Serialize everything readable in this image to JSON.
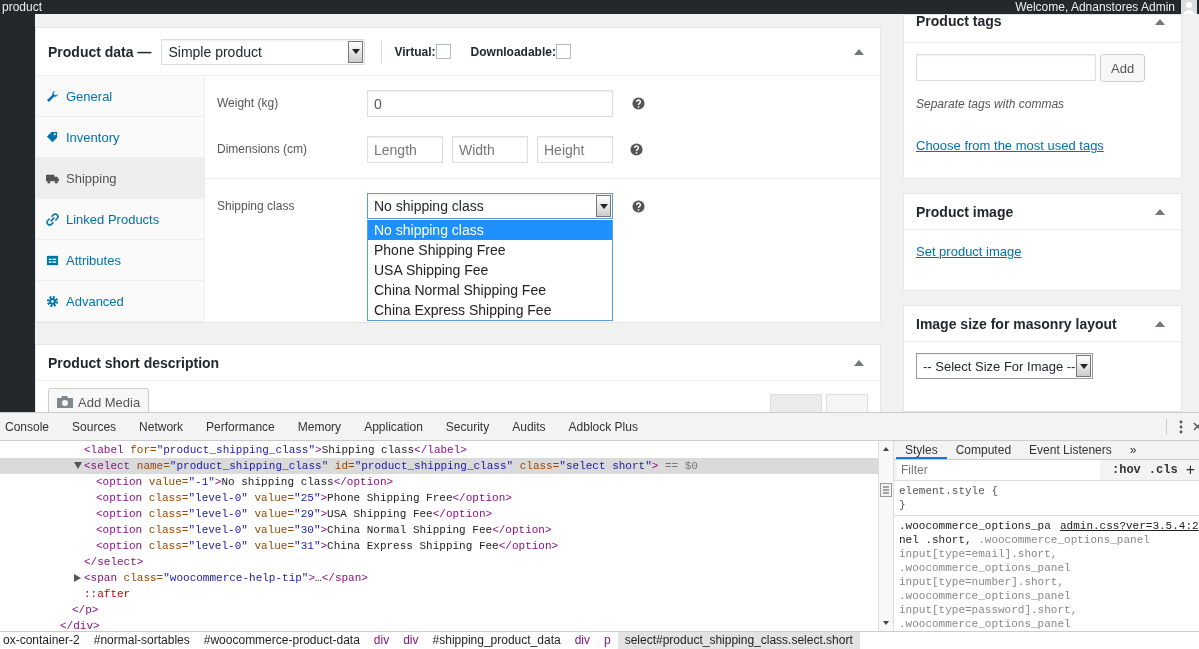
{
  "admin_bar": {
    "title": "product",
    "welcome": "Welcome, Adnanstores Admin"
  },
  "product_data": {
    "title": "Product data —",
    "type_select": "Simple product",
    "virtual": {
      "label": "Virtual:",
      "checked": false
    },
    "downloadable": {
      "label": "Downloadable:",
      "checked": false
    },
    "tabs": [
      {
        "label": "General",
        "selected": false
      },
      {
        "label": "Inventory",
        "selected": false
      },
      {
        "label": "Shipping",
        "selected": true
      },
      {
        "label": "Linked Products",
        "selected": false
      },
      {
        "label": "Attributes",
        "selected": false
      },
      {
        "label": "Advanced",
        "selected": false
      }
    ],
    "weight": {
      "label": "Weight (kg)",
      "value": "0"
    },
    "dimensions": {
      "label": "Dimensions (cm)",
      "placeholders": [
        "Length",
        "Width",
        "Height"
      ]
    },
    "shipping_class": {
      "label": "Shipping class",
      "value": "No shipping class",
      "expanded": true,
      "options": [
        {
          "label": "No shipping class",
          "selected": true
        },
        {
          "label": "Phone Shipping Free",
          "selected": false
        },
        {
          "label": "USA Shipping Fee",
          "selected": false
        },
        {
          "label": "China Normal Shipping Fee",
          "selected": false
        },
        {
          "label": "China Express Shipping Fee",
          "selected": false
        }
      ]
    }
  },
  "short_description": {
    "title": "Product short description",
    "add_media": "Add Media"
  },
  "product_tags": {
    "title": "Product tags",
    "button": "Add",
    "hint": "Separate tags with commas",
    "link": "Choose from the most used tags"
  },
  "product_image": {
    "title": "Product image",
    "link": "Set product image"
  },
  "image_size": {
    "title": "Image size for masonry layout",
    "select": "-- Select Size For Image --"
  },
  "devtools": {
    "tabs": [
      "Console",
      "Sources",
      "Network",
      "Performance",
      "Memory",
      "Application",
      "Security",
      "Audits",
      "Adblock Plus"
    ],
    "elements": {
      "nodes": [
        {
          "children": [
            {
              "children": [
                {
                  "selected": false,
                  "line": [
                    {
                      "kind": "tag",
                      "text": "<label"
                    },
                    {
                      "kind": "attr",
                      "text": " for="
                    },
                    {
                      "kind": "value",
                      "text": "\"product_shipping_class\""
                    },
                    {
                      "kind": "tag",
                      "text": ">"
                    },
                    {
                      "kind": "text",
                      "text": "Shipping class"
                    },
                    {
                      "kind": "tag",
                      "text": "</label>"
                    }
                  ]
                },
                {
                  "selected": true,
                  "expanded": true,
                  "line": [
                    {
                      "kind": "tag",
                      "text": "<select"
                    },
                    {
                      "kind": "attr",
                      "text": " name="
                    },
                    {
                      "kind": "value",
                      "text": "\"product_shipping_class\""
                    },
                    {
                      "kind": "attr",
                      "text": " id="
                    },
                    {
                      "kind": "value",
                      "text": "\"product_shipping_class\""
                    },
                    {
                      "kind": "attr",
                      "text": " class="
                    },
                    {
                      "kind": "value",
                      "text": "\"select short\""
                    },
                    {
                      "kind": "tag",
                      "text": ">"
                    },
                    {
                      "kind": "marker",
                      "text": " == $0"
                    }
                  ],
                  "children": [
                    {
                      "selected": false,
                      "line": [
                        {
                          "kind": "tag",
                          "text": "<option"
                        },
                        {
                          "kind": "attr",
                          "text": " value="
                        },
                        {
                          "kind": "value",
                          "text": "\"-1\""
                        },
                        {
                          "kind": "tag",
                          "text": ">"
                        },
                        {
                          "kind": "text",
                          "text": "No shipping class"
                        },
                        {
                          "kind": "tag",
                          "text": "</option>"
                        }
                      ]
                    },
                    {
                      "selected": false,
                      "line": [
                        {
                          "kind": "tag",
                          "text": "<option"
                        },
                        {
                          "kind": "attr",
                          "text": " class="
                        },
                        {
                          "kind": "value",
                          "text": "\"level-0\""
                        },
                        {
                          "kind": "attr",
                          "text": " value="
                        },
                        {
                          "kind": "value",
                          "text": "\"25\""
                        },
                        {
                          "kind": "tag",
                          "text": ">"
                        },
                        {
                          "kind": "text",
                          "text": "Phone Shipping Free"
                        },
                        {
                          "kind": "tag",
                          "text": "</option>"
                        }
                      ]
                    },
                    {
                      "selected": false,
                      "line": [
                        {
                          "kind": "tag",
                          "text": "<option"
                        },
                        {
                          "kind": "attr",
                          "text": " class="
                        },
                        {
                          "kind": "value",
                          "text": "\"level-0\""
                        },
                        {
                          "kind": "attr",
                          "text": " value="
                        },
                        {
                          "kind": "value",
                          "text": "\"29\""
                        },
                        {
                          "kind": "tag",
                          "text": ">"
                        },
                        {
                          "kind": "text",
                          "text": "USA Shipping Fee"
                        },
                        {
                          "kind": "tag",
                          "text": "</option>"
                        }
                      ]
                    },
                    {
                      "selected": false,
                      "line": [
                        {
                          "kind": "tag",
                          "text": "<option"
                        },
                        {
                          "kind": "attr",
                          "text": " class="
                        },
                        {
                          "kind": "value",
                          "text": "\"level-0\""
                        },
                        {
                          "kind": "attr",
                          "text": " value="
                        },
                        {
                          "kind": "value",
                          "text": "\"30\""
                        },
                        {
                          "kind": "tag",
                          "text": ">"
                        },
                        {
                          "kind": "text",
                          "text": "China Normal Shipping Fee"
                        },
                        {
                          "kind": "tag",
                          "text": "</option>"
                        }
                      ]
                    },
                    {
                      "selected": false,
                      "line": [
                        {
                          "kind": "tag",
                          "text": "<option"
                        },
                        {
                          "kind": "attr",
                          "text": " class="
                        },
                        {
                          "kind": "value",
                          "text": "\"level-0\""
                        },
                        {
                          "kind": "attr",
                          "text": " value="
                        },
                        {
                          "kind": "value",
                          "text": "\"31\""
                        },
                        {
                          "kind": "tag",
                          "text": ">"
                        },
                        {
                          "kind": "text",
                          "text": "China Express Shipping Fee"
                        },
                        {
                          "kind": "tag",
                          "text": "</option>"
                        }
                      ]
                    }
                  ],
                  "close": [
                    {
                      "kind": "tag",
                      "text": "</select>"
                    }
                  ]
                },
                {
                  "selected": false,
                  "expanded": false,
                  "line": [
                    {
                      "kind": "tag",
                      "text": "<span"
                    },
                    {
                      "kind": "attr",
                      "text": " class="
                    },
                    {
                      "kind": "value",
                      "text": "\"woocommerce-help-tip\""
                    },
                    {
                      "kind": "tag",
                      "text": ">"
                    },
                    {
                      "kind": "text",
                      "text": "…"
                    },
                    {
                      "kind": "tag",
                      "text": "</span>"
                    }
                  ]
                },
                {
                  "selected": false,
                  "line": [
                    {
                      "kind": "pseudo",
                      "text": "::after"
                    }
                  ]
                }
              ],
              "close": [
                {
                  "kind": "tag",
                  "text": "</p>"
                }
              ]
            }
          ],
          "close": [
            {
              "kind": "tag",
              "text": "</div>"
            }
          ]
        }
      ]
    },
    "styles": {
      "tabs": [
        {
          "label": "Styles",
          "selected": true
        },
        {
          "label": "Computed",
          "selected": false
        },
        {
          "label": "Event Listeners",
          "selected": false
        },
        {
          "label": "»",
          "selected": false
        }
      ],
      "filter_placeholder": "Filter",
      "hov": ":hov",
      "cls": ".cls",
      "add": "+",
      "element_style": [
        "element.style {",
        "}"
      ],
      "source_link": "admin.css?ver=3.5.4:2",
      "rule": [
        [
          {
            "matched": true,
            "text": ".woocommerce_options_pa"
          }
        ],
        [
          {
            "matched": true,
            "text": "nel .short, "
          },
          {
            "matched": false,
            "text": ".woocommerce_options_panel"
          }
        ],
        [
          {
            "matched": false,
            "text": "input[type=email].short,"
          }
        ],
        [
          {
            "matched": false,
            "text": ".woocommerce_options_panel"
          }
        ],
        [
          {
            "matched": false,
            "text": "input[type=number].short,"
          }
        ],
        [
          {
            "matched": false,
            "text": ".woocommerce_options_panel"
          }
        ],
        [
          {
            "matched": false,
            "text": "input[type=password].short,"
          }
        ],
        [
          {
            "matched": false,
            "text": ".woocommerce_options_panel"
          }
        ]
      ]
    },
    "breadcrumbs": [
      {
        "label": "ox-container-2",
        "kind": "id",
        "selected": false
      },
      {
        "label": "#normal-sortables",
        "kind": "id",
        "selected": false
      },
      {
        "label": "#woocommerce-product-data",
        "kind": "id",
        "selected": false
      },
      {
        "label": "div",
        "kind": "tag",
        "selected": false
      },
      {
        "label": "div",
        "kind": "tag",
        "selected": false
      },
      {
        "label": "#shipping_product_data",
        "kind": "id",
        "selected": false
      },
      {
        "label": "div",
        "kind": "tag",
        "selected": false
      },
      {
        "label": "p",
        "kind": "tag",
        "selected": false
      },
      {
        "label": "select#product_shipping_class.select.short",
        "kind": "tag",
        "selected": true
      }
    ]
  }
}
